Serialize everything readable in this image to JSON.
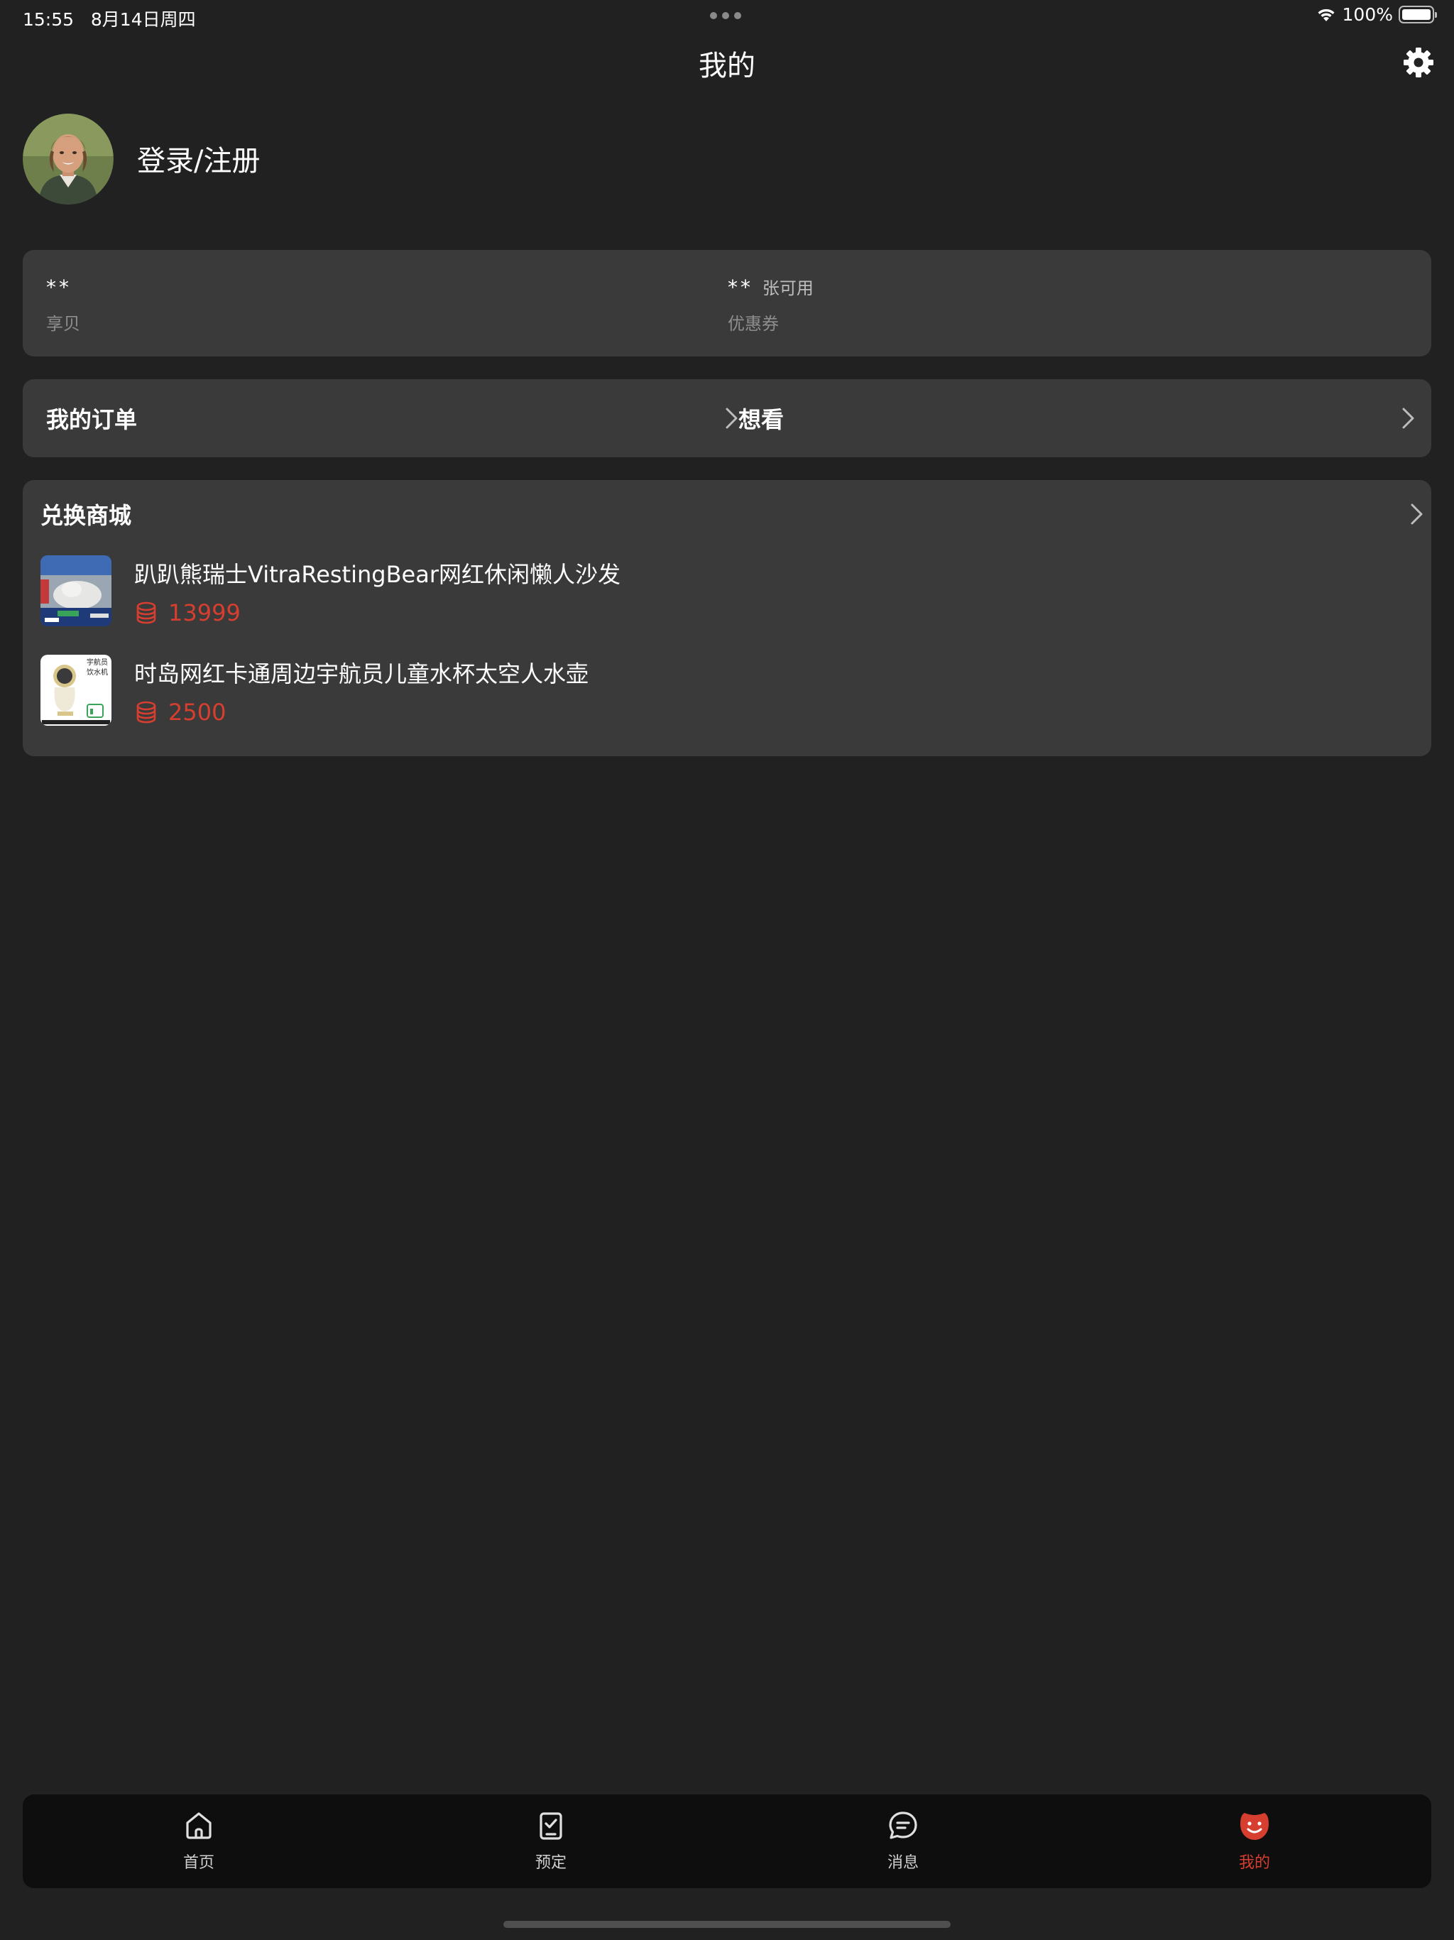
{
  "status_bar": {
    "time": "15:55",
    "date": "8月14日周四",
    "battery": "100%"
  },
  "header": {
    "title": "我的",
    "settings_icon": "gear-icon"
  },
  "profile": {
    "login_label": "登录/注册",
    "avatar": "user-avatar-photo"
  },
  "stats": {
    "points_value": "**",
    "points_label": "享贝",
    "coupons_value": "**",
    "coupons_suffix": "张可用",
    "coupons_label": "优惠券"
  },
  "orders": {
    "my_orders_label": "我的订单",
    "watchlist_label": "想看"
  },
  "store": {
    "title": "兑换商城",
    "products": [
      {
        "name": "趴趴熊瑞士VitraRestingBear网红休闲懒人沙发",
        "price": "13999",
        "thumb_text": ""
      },
      {
        "name": "时岛网红卡通周边宇航员儿童水杯太空人水壶",
        "price": "2500",
        "thumb_text": "宇航员 饮水机"
      }
    ]
  },
  "tab_bar": {
    "items": [
      {
        "label": "首页",
        "icon": "home-icon",
        "active": false
      },
      {
        "label": "预定",
        "icon": "clipboard-check-icon",
        "active": false
      },
      {
        "label": "消息",
        "icon": "chat-bubble-icon",
        "active": false
      },
      {
        "label": "我的",
        "icon": "smiley-face-icon",
        "active": true
      }
    ]
  },
  "colors": {
    "background": "#212121",
    "card": "#3a3a3a",
    "tab_bar": "#0e0e0e",
    "accent": "#d63e2f",
    "muted_text": "#8e8e8e"
  }
}
